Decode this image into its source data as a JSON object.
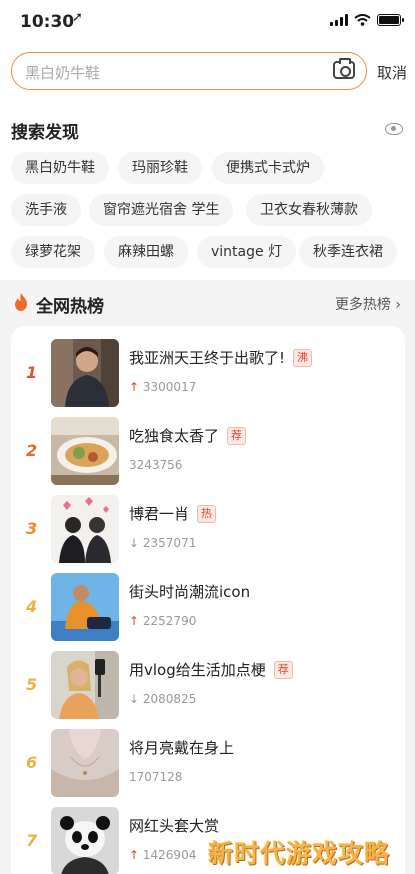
{
  "status_bar": {
    "time": "10:30",
    "location_glyph": "➚"
  },
  "search": {
    "placeholder": "黑白奶牛鞋",
    "cancel_label": "取消"
  },
  "discover": {
    "title": "搜索发现",
    "chips": [
      "黑白奶牛鞋",
      "玛丽珍鞋",
      "便携式卡式炉",
      "洗手液",
      "窗帘遮光宿舍 学生",
      "卫衣女春秋薄款",
      "绿萝花架",
      "麻辣田螺",
      "vintage 灯",
      "秋季连衣裙"
    ]
  },
  "hot": {
    "title": "全网热榜",
    "more_label": "更多热榜 ›",
    "items": [
      {
        "rank": "1",
        "title": "我亚洲天王终于出歌了!",
        "tag": "沸",
        "trend": "up",
        "trend_glyph": "↑",
        "heat": "3300017",
        "rank_color": "#e0552b"
      },
      {
        "rank": "2",
        "title": "吃独食太香了",
        "tag": "荐",
        "trend": "none",
        "trend_glyph": "",
        "heat": "3243756",
        "rank_color": "#e66a2b"
      },
      {
        "rank": "3",
        "title": "博君一肖",
        "tag": "热",
        "trend": "down",
        "trend_glyph": "↓",
        "heat": "2357071",
        "rank_color": "#ee8a2f"
      },
      {
        "rank": "4",
        "title": "街头时尚潮流icon",
        "tag": "",
        "trend": "up",
        "trend_glyph": "↑",
        "heat": "2252790",
        "rank_color": "#e8b343"
      },
      {
        "rank": "5",
        "title": "用vlog给生活加点梗",
        "tag": "荐",
        "trend": "down",
        "trend_glyph": "↓",
        "heat": "2080825",
        "rank_color": "#e8b343"
      },
      {
        "rank": "6",
        "title": "将月亮戴在身上",
        "tag": "",
        "trend": "none",
        "trend_glyph": "",
        "heat": "1707128",
        "rank_color": "#e8b343"
      },
      {
        "rank": "7",
        "title": "网红头套大赏",
        "tag": "",
        "trend": "up",
        "trend_glyph": "↑",
        "heat": "1426904",
        "rank_color": "#e8b343"
      }
    ]
  },
  "watermark": "新时代游戏攻略",
  "colors": {
    "accent": "#f08a3e",
    "tag_red": "#e0442b"
  }
}
